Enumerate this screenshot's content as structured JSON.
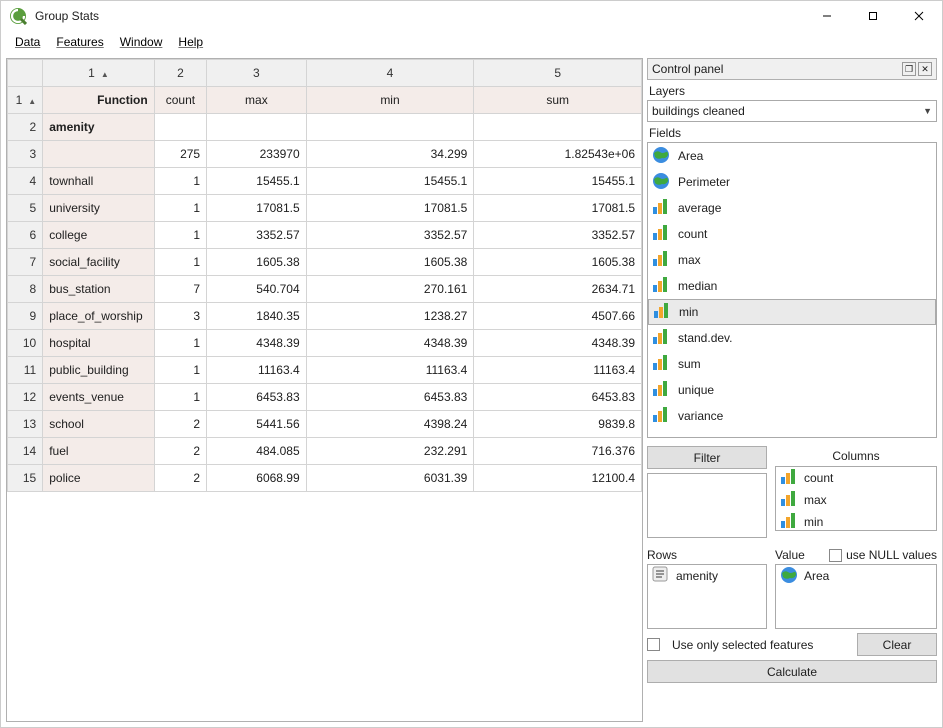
{
  "window": {
    "title": "Group Stats"
  },
  "menu": [
    "Data",
    "Features",
    "Window",
    "Help"
  ],
  "grid": {
    "top_cols": [
      "1",
      "2",
      "3",
      "4",
      "5"
    ],
    "function_label": "Function",
    "func_row": [
      "count",
      "max",
      "min",
      "sum"
    ],
    "group_header": "amenity",
    "rows": [
      {
        "n": "3",
        "label": "",
        "vals": [
          "275",
          "233970",
          "34.299",
          "1.82543e+06"
        ]
      },
      {
        "n": "4",
        "label": "townhall",
        "vals": [
          "1",
          "15455.1",
          "15455.1",
          "15455.1"
        ]
      },
      {
        "n": "5",
        "label": "university",
        "vals": [
          "1",
          "17081.5",
          "17081.5",
          "17081.5"
        ]
      },
      {
        "n": "6",
        "label": "college",
        "vals": [
          "1",
          "3352.57",
          "3352.57",
          "3352.57"
        ]
      },
      {
        "n": "7",
        "label": "social_facility",
        "vals": [
          "1",
          "1605.38",
          "1605.38",
          "1605.38"
        ]
      },
      {
        "n": "8",
        "label": "bus_station",
        "vals": [
          "7",
          "540.704",
          "270.161",
          "2634.71"
        ]
      },
      {
        "n": "9",
        "label": "place_of_worship",
        "vals": [
          "3",
          "1840.35",
          "1238.27",
          "4507.66"
        ]
      },
      {
        "n": "10",
        "label": "hospital",
        "vals": [
          "1",
          "4348.39",
          "4348.39",
          "4348.39"
        ]
      },
      {
        "n": "11",
        "label": "public_building",
        "vals": [
          "1",
          "11163.4",
          "11163.4",
          "11163.4"
        ]
      },
      {
        "n": "12",
        "label": "events_venue",
        "vals": [
          "1",
          "6453.83",
          "6453.83",
          "6453.83"
        ]
      },
      {
        "n": "13",
        "label": "school",
        "vals": [
          "2",
          "5441.56",
          "4398.24",
          "9839.8"
        ]
      },
      {
        "n": "14",
        "label": "fuel",
        "vals": [
          "2",
          "484.085",
          "232.291",
          "716.376"
        ]
      },
      {
        "n": "15",
        "label": "police",
        "vals": [
          "2",
          "6068.99",
          "6031.39",
          "12100.4"
        ]
      }
    ]
  },
  "panel": {
    "title": "Control panel",
    "layers_label": "Layers",
    "layer_selected": "buildings cleaned",
    "fields_label": "Fields",
    "fields": [
      {
        "icon": "globe",
        "label": "Area"
      },
      {
        "icon": "globe",
        "label": "Perimeter"
      },
      {
        "icon": "bars",
        "label": "average"
      },
      {
        "icon": "bars",
        "label": "count"
      },
      {
        "icon": "bars",
        "label": "max"
      },
      {
        "icon": "bars",
        "label": "median"
      },
      {
        "icon": "bars",
        "label": "min",
        "selected": true
      },
      {
        "icon": "bars",
        "label": "stand.dev."
      },
      {
        "icon": "bars",
        "label": "sum"
      },
      {
        "icon": "bars",
        "label": "unique"
      },
      {
        "icon": "bars",
        "label": "variance"
      }
    ],
    "filter_label": "Filter",
    "columns_label": "Columns",
    "columns": [
      {
        "icon": "bars",
        "label": "count"
      },
      {
        "icon": "bars",
        "label": "max"
      },
      {
        "icon": "bars",
        "label": "min"
      }
    ],
    "rows_label": "Rows",
    "value_label": "Value",
    "use_null_label": "use NULL values",
    "rows_items": [
      {
        "icon": "text",
        "label": "amenity"
      }
    ],
    "value_items": [
      {
        "icon": "globe",
        "label": "Area"
      }
    ],
    "use_selected_label": "Use only selected features",
    "clear_label": "Clear",
    "calculate_label": "Calculate"
  }
}
